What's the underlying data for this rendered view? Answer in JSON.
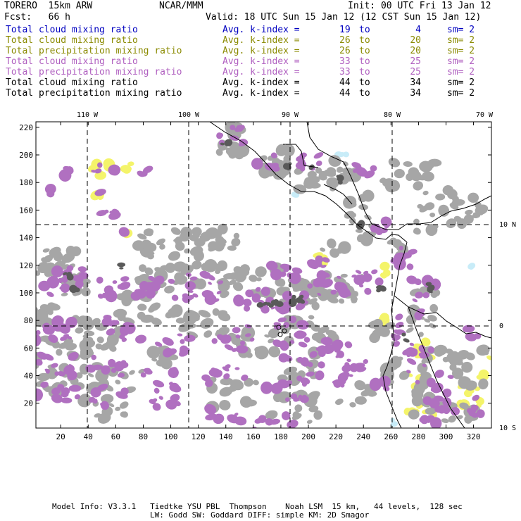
{
  "header": {
    "model": "TORERO  15km ARW",
    "org": "NCAR/MMM",
    "init": "Init: 00 UTC Fri 13 Jan 12",
    "fcst": "Fcst:   66 h",
    "valid": "Valid: 18 UTC Sun 15 Jan 12 (12 CST Sun 15 Jan 12)"
  },
  "legend": [
    {
      "field": "Total cloud mixing ratio",
      "avg": "Avg. k-index =",
      "a": "19",
      "to": "to",
      "b": "4",
      "sm": "sm= 2",
      "color": "#0000c0"
    },
    {
      "field": "Total cloud mixing ratio",
      "avg": "Avg. k-index =",
      "a": "26",
      "to": "to",
      "b": "20",
      "sm": "sm= 2",
      "color": "#8a8a00"
    },
    {
      "field": "Total precipitation mixing ratio",
      "avg": "Avg. k-index =",
      "a": "26",
      "to": "to",
      "b": "20",
      "sm": "sm= 2",
      "color": "#8a8a00"
    },
    {
      "field": "Total cloud mixing ratio",
      "avg": "Avg. k-index =",
      "a": "33",
      "to": "to",
      "b": "25",
      "sm": "sm= 2",
      "color": "#b060c0"
    },
    {
      "field": "Total precipitation mixing ratio",
      "avg": "Avg. k-index =",
      "a": "33",
      "to": "to",
      "b": "25",
      "sm": "sm= 2",
      "color": "#b060c0"
    },
    {
      "field": "Total cloud mixing ratio",
      "avg": "Avg. k-index =",
      "a": "44",
      "to": "to",
      "b": "34",
      "sm": "sm= 2",
      "color": "#000000"
    },
    {
      "field": "Total precipitation mixing ratio",
      "avg": "Avg. k-index =",
      "a": "44",
      "to": "to",
      "b": "34",
      "sm": "sm= 2",
      "color": "#000000"
    }
  ],
  "map": {
    "x_ticks": [
      "20",
      "40",
      "60",
      "80",
      "100",
      "120",
      "140",
      "160",
      "180",
      "200",
      "220",
      "240",
      "260",
      "280",
      "300",
      "320"
    ],
    "y_ticks": [
      "20",
      "40",
      "60",
      "80",
      "100",
      "120",
      "140",
      "160",
      "180",
      "200",
      "220"
    ],
    "lon_labels": [
      "110 W",
      "100 W",
      "90 W",
      "80 W",
      "70 W"
    ],
    "lat_labels": [
      "10 N",
      "0",
      "10 S"
    ]
  },
  "footer": {
    "line1": "Model Info: V3.3.1   Tiedtke YSU PBL  Thompson    Noah LSM  15 km,   44 levels,  128 sec",
    "line2": "LW: Godd SW: Goddard DIFF: simple KM: 2D Smagor"
  },
  "colors": {
    "gray": "#a6a6a6",
    "dark_gray": "#5a5a5a",
    "purple": "#b070c0",
    "yellow": "#f4f46a",
    "light_blue": "#c8ecf8"
  }
}
